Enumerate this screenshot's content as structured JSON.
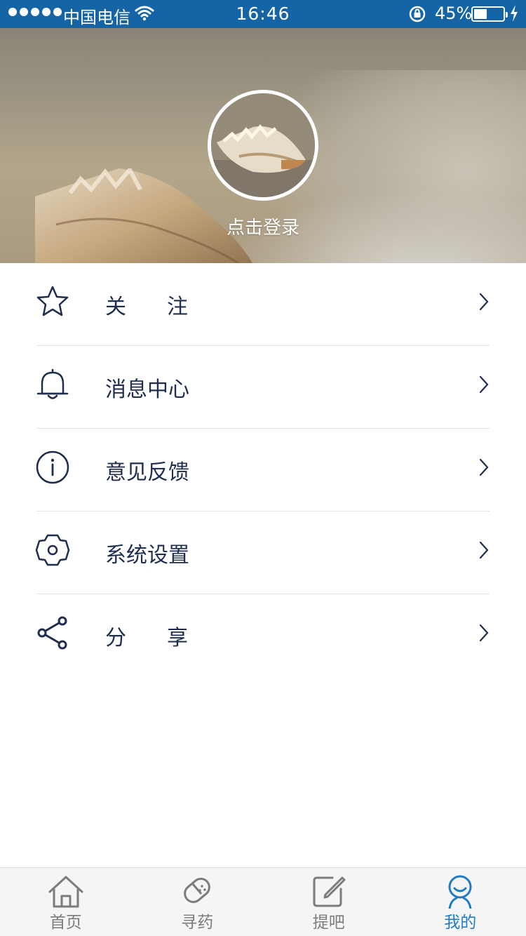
{
  "status_bar": {
    "carrier": "中国电信",
    "time": "16:46",
    "battery_percent": "45%",
    "battery_level": 0.45
  },
  "profile": {
    "login_label": "点击登录"
  },
  "menu": {
    "items": [
      {
        "label": "关注",
        "icon": "star-icon"
      },
      {
        "label": "消息中心",
        "icon": "bell-icon"
      },
      {
        "label": "意见反馈",
        "icon": "info-icon"
      },
      {
        "label": "系统设置",
        "icon": "gear-icon"
      },
      {
        "label": "分享",
        "icon": "share-icon"
      }
    ]
  },
  "tab_bar": {
    "tabs": [
      {
        "label": "首页",
        "icon": "home-icon",
        "active": false
      },
      {
        "label": "寻药",
        "icon": "pill-icon",
        "active": false
      },
      {
        "label": "提吧",
        "icon": "edit-icon",
        "active": false
      },
      {
        "label": "我的",
        "icon": "user-icon",
        "active": true
      }
    ]
  },
  "colors": {
    "status_bar": "#1565a6",
    "menu_text": "#1f2d4e",
    "tab_active": "#1f7cc1",
    "tab_inactive": "#7c7c7c"
  }
}
